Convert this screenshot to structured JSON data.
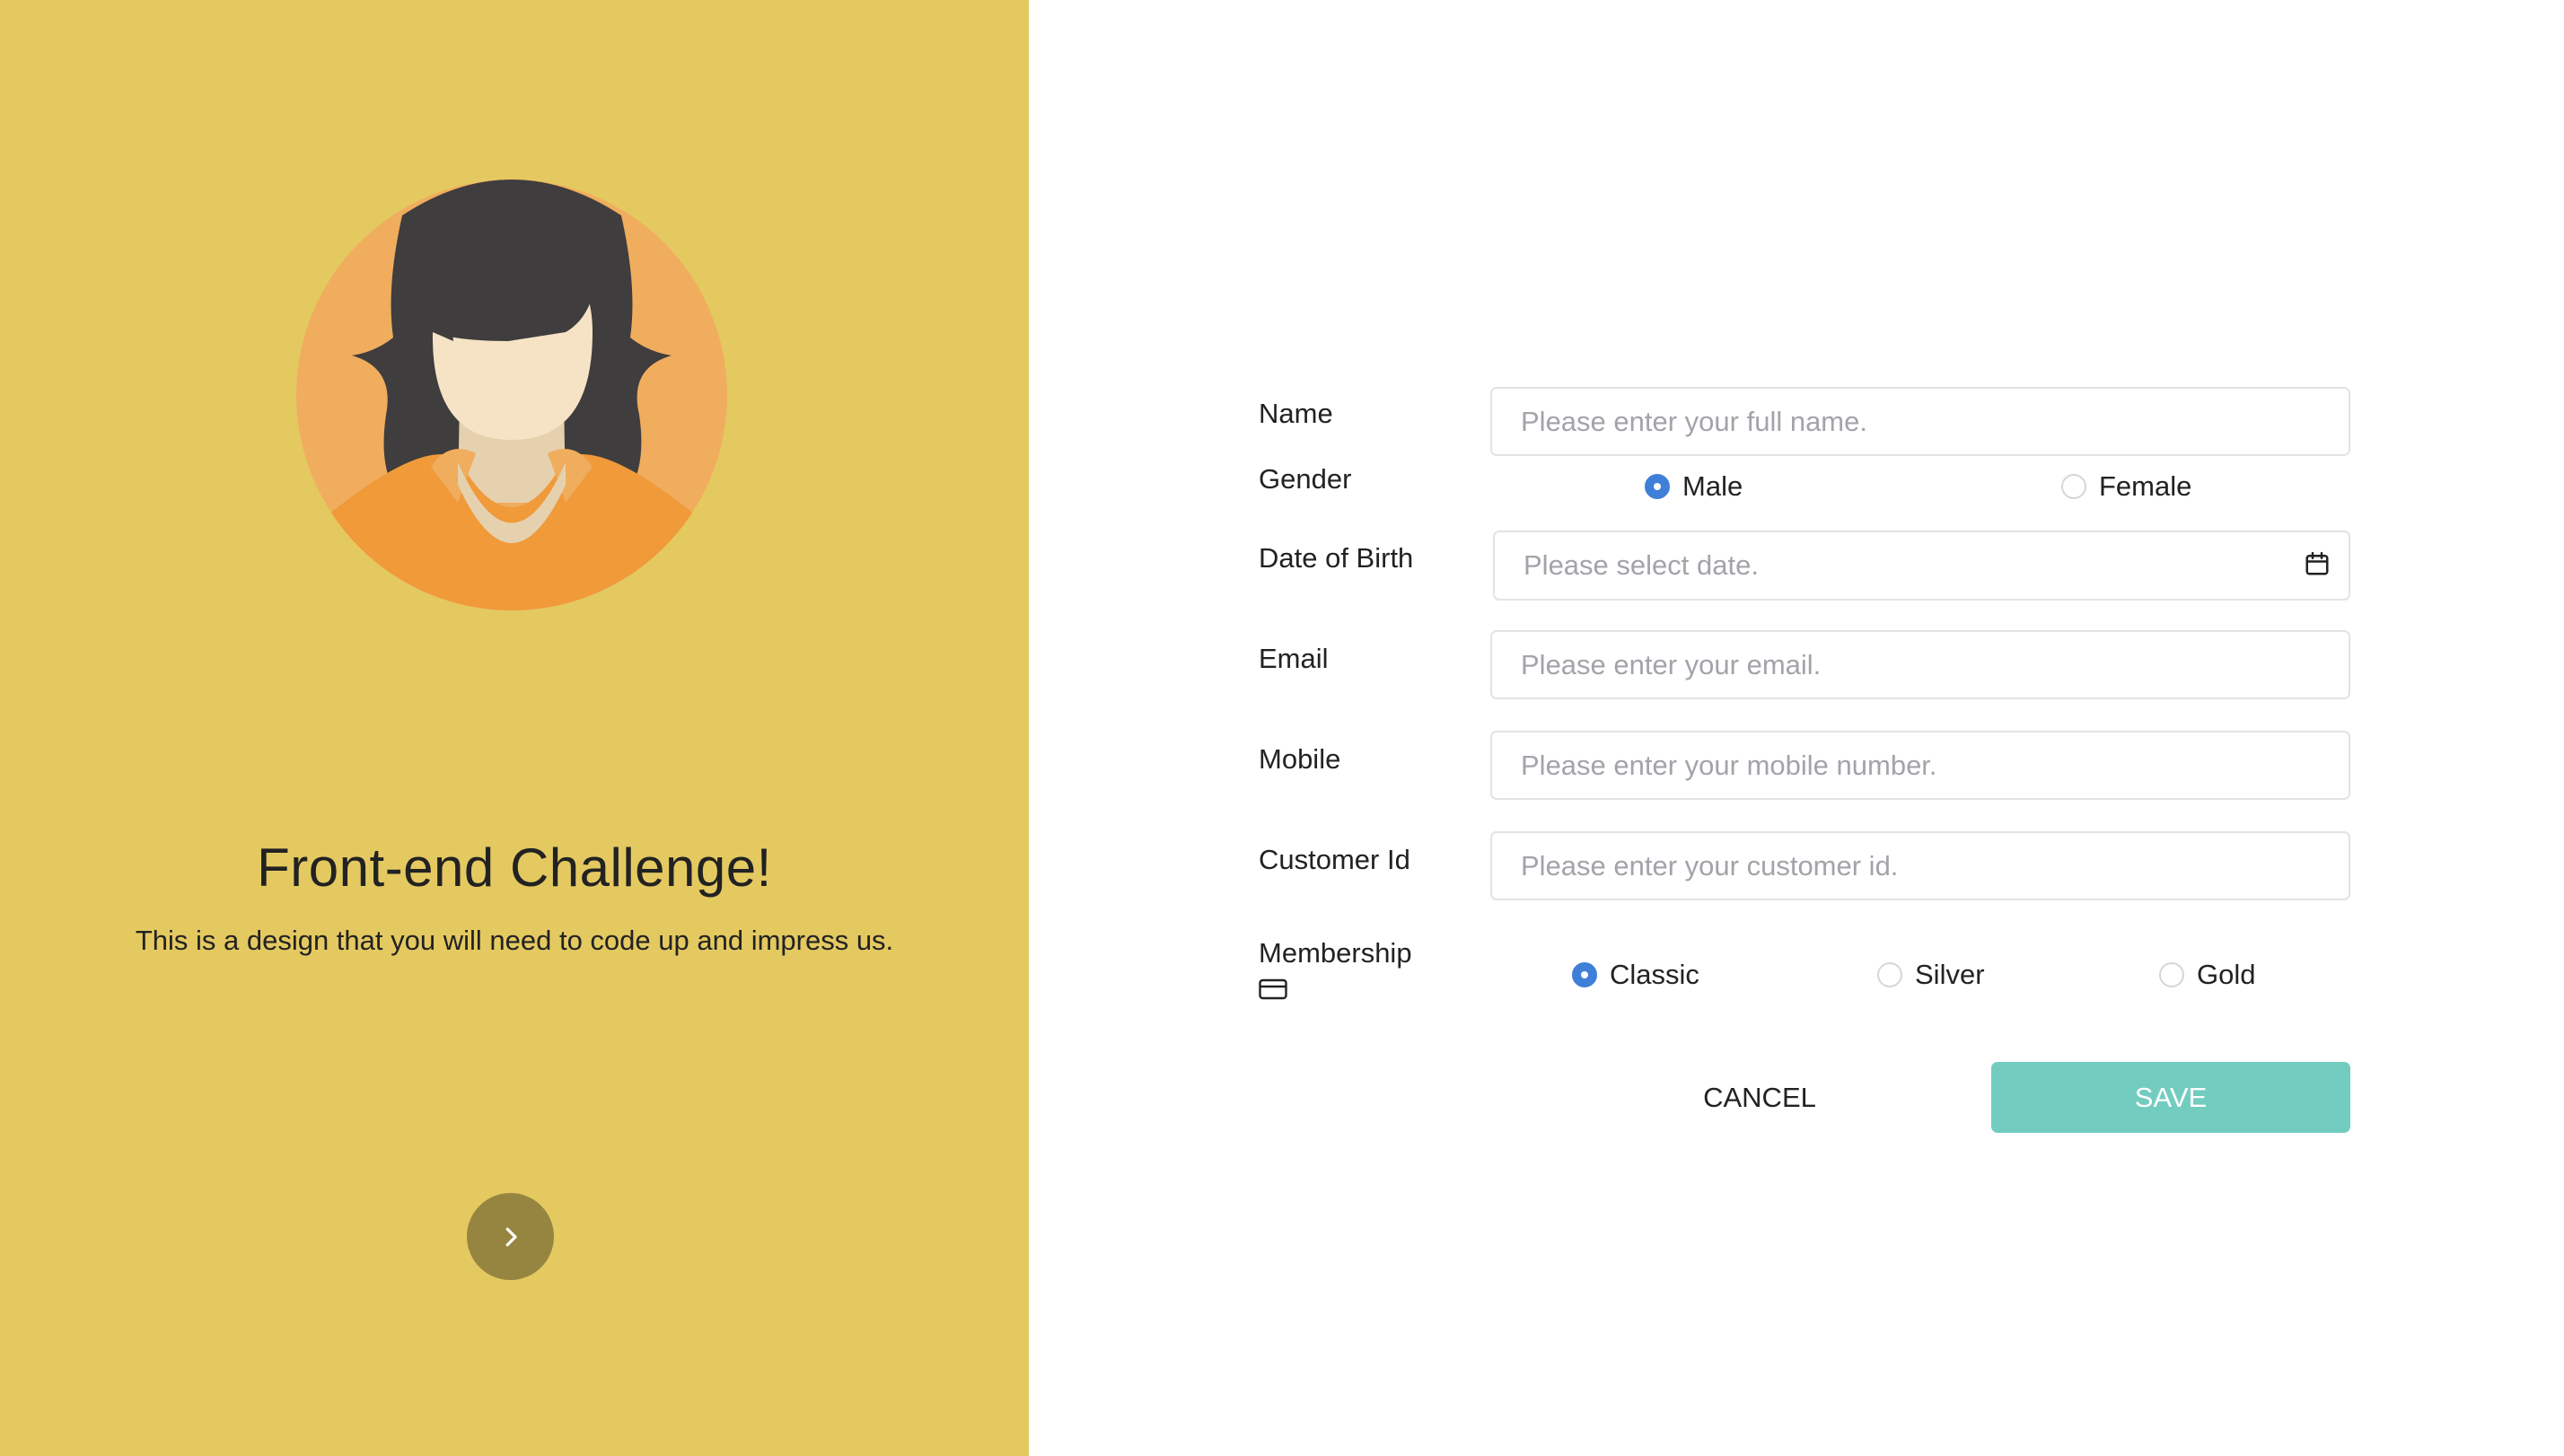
{
  "hero": {
    "title": "Front-end Challenge!",
    "subtitle": "This is a design that you will need to code up and impress us.",
    "next_icon": "chevron-right-icon",
    "avatar_icon": "female-avatar-icon"
  },
  "form": {
    "name": {
      "label": "Name",
      "placeholder": "Please enter your full name."
    },
    "gender": {
      "label": "Gender",
      "options": [
        "Male",
        "Female"
      ],
      "selected": "Male"
    },
    "dob": {
      "label": "Date of Birth",
      "placeholder": "Please select date.",
      "icon": "calendar-icon"
    },
    "email": {
      "label": "Email",
      "placeholder": "Please enter your email."
    },
    "mobile": {
      "label": "Mobile",
      "placeholder": "Please enter your mobile number."
    },
    "customer_id": {
      "label": "Customer Id",
      "placeholder": "Please enter your customer id."
    },
    "membership": {
      "label": "Membership",
      "icon": "credit-card-icon",
      "options": [
        "Classic",
        "Silver",
        "Gold"
      ],
      "selected": "Classic"
    },
    "cancel_label": "CANCEL",
    "save_label": "SAVE"
  },
  "colors": {
    "left_panel": "#e4c961",
    "next_button": "#968541",
    "radio_selected": "#3f7fd8",
    "save_button": "#73ccc0",
    "avatar_bg": "#f0ad5d",
    "hair": "#3f3d3d",
    "skin": "#f6e3c6",
    "shirt": "#f09a3a"
  }
}
